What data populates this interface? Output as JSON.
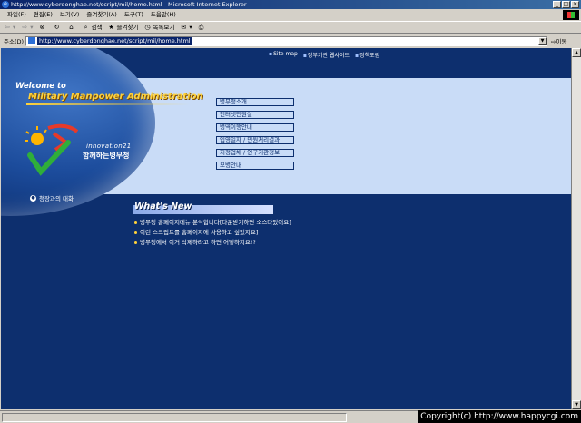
{
  "window": {
    "title": "http://www.cyberdonghae.net/script/mil/home.html - Microsoft Internet Explorer",
    "buttons": [
      "_",
      "□",
      "×"
    ]
  },
  "menubar": [
    "파일(F)",
    "편집(E)",
    "보기(V)",
    "즐겨찾기(A)",
    "도구(T)",
    "도움말(H)"
  ],
  "toolbar": {
    "back_icon": "back-arrow-icon",
    "forward_icon": "forward-arrow-icon",
    "stop_icon": "stop-icon",
    "refresh_icon": "refresh-icon",
    "home_icon": "home-icon",
    "search_label": "검색",
    "favorites_label": "즐겨찾기",
    "history_label": "목록보기"
  },
  "address": {
    "label": "주소(D)",
    "url": "http://www.cyberdonghae.net/script/mil/home.html",
    "go_label": "이동"
  },
  "page": {
    "top_links": [
      "Site map",
      "정부기관 웹사이트",
      "정책포럼"
    ],
    "welcome": "Welcome to",
    "org_name": "Military Manpower Administration",
    "innovation": "innovation21",
    "slogan": "함께하는병무청",
    "dialog_link": "청장과의 대화",
    "menu": [
      "병무청소개",
      "인터넷민원실",
      "병역이행안내",
      "입영일자 / 민원처리결과",
      "지정업체 / 연구기관정보",
      "모병안내"
    ],
    "whats_new_title": "What's New",
    "news": [
      "병무청 홈페이지메뉴 분석합니다[다운받기하면 소스다있어요]",
      "이런 스크립트를 홈페이지에 사용하고 싶었지요]",
      "병무청에서 이거 삭제하라고 하면 어떻하지요!?"
    ]
  },
  "copyright": "Copyright(c) http://www.happycgi.com",
  "colors": {
    "page_bg": "#0d2f6e",
    "light_band": "#c9dcf7",
    "accent_yellow": "#ffd23a",
    "titlebar": "#0a246a"
  }
}
